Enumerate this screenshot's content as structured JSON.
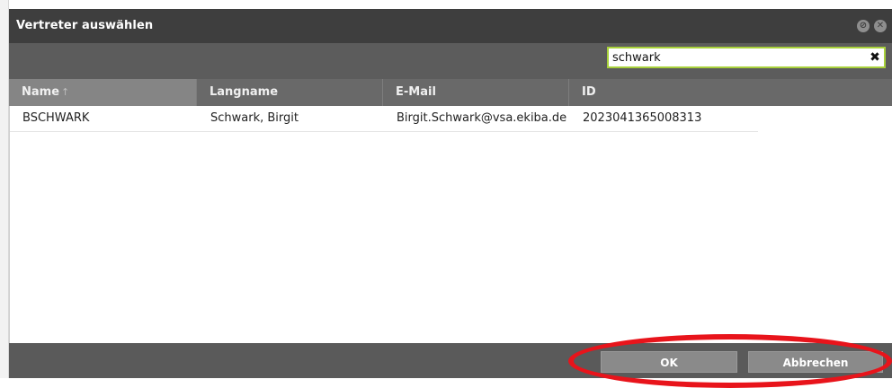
{
  "dialog": {
    "title": "Vertreter auswählen",
    "controls": [
      {
        "icon": "collapse-icon",
        "glyph": "⊘"
      },
      {
        "icon": "close-icon",
        "glyph": "✕"
      }
    ]
  },
  "search": {
    "value": "schwark",
    "clear_glyph": "✖"
  },
  "table": {
    "columns": [
      {
        "label": "Name",
        "sort_glyph": "↑"
      },
      {
        "label": "Langname"
      },
      {
        "label": "E-Mail"
      },
      {
        "label": "ID"
      }
    ],
    "rows": [
      {
        "name": "BSCHWARK",
        "langname": "Schwark, Birgit",
        "email": "Birgit.Schwark@vsa.ekiba.de",
        "id": "2023041365008313"
      }
    ]
  },
  "footer": {
    "ok_label": "OK",
    "cancel_label": "Abbrechen"
  },
  "colors": {
    "titlebar": "#3e3e3e",
    "toolbar": "#5c5c5c",
    "search_border": "#a8d13b",
    "annotation": "#e8141b"
  }
}
